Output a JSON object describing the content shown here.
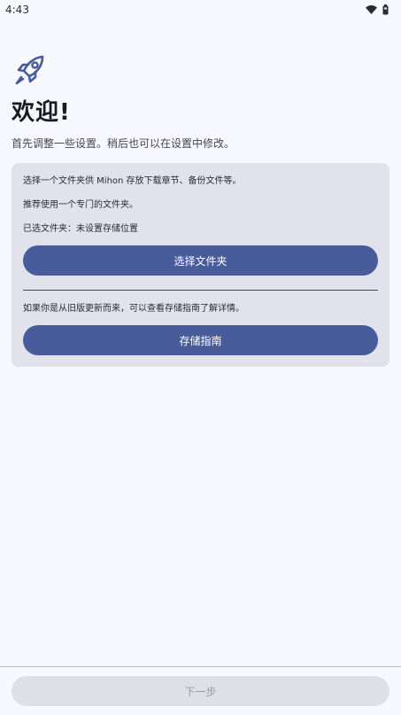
{
  "status": {
    "time": "4:43",
    "wifi_icon": "wifi-icon",
    "battery_icon": "battery-icon"
  },
  "welcome": {
    "icon": "rocket-icon",
    "title": "欢迎!",
    "subtitle": "首先调整一些设置。稍后也可以在设置中修改。"
  },
  "storage_card": {
    "line1": "选择一个文件夹供 Mihon 存放下载章节、备份文件等。",
    "line2": "推荐使用一个专门的文件夹。",
    "selected_label": "已选文件夹：未设置存储位置",
    "choose_button": "选择文件夹",
    "update_note": "如果你是从旧版更新而来，可以查看存储指南了解详情。",
    "guide_button": "存储指南"
  },
  "footer": {
    "next_button": "下一步"
  },
  "colors": {
    "accent": "#485b9a",
    "card_bg": "#e1e2ec",
    "page_bg": "#f8f9ff"
  }
}
